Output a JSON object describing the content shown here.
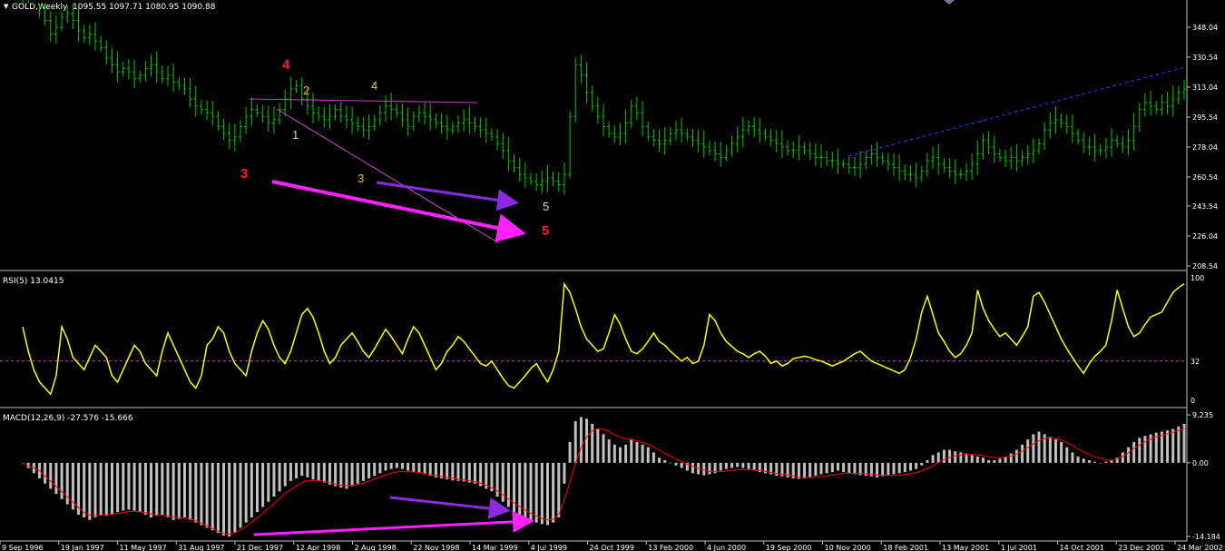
{
  "window": {
    "symbol_title": "GOLD,Weekly",
    "ohlc": "1095.55 1097.71 1080.95 1090.88"
  },
  "colors": {
    "background": "#000000",
    "candles": "#00c800",
    "rsi_line": "#ffff00",
    "macd_hist": "#c0c0c0",
    "macd_signal": "#ff0000",
    "trendline": "#cc44cc",
    "arrow_magenta": "#ff22ff",
    "arrow_violet": "#8a2be2",
    "channel_blue": "#2a3cff",
    "wave_red": "#ff2020",
    "wave_yellow": "#e8c040",
    "wave_white": "#d8d8d8"
  },
  "chart_data": [
    {
      "type": "candlestick",
      "title": "GOLD,Weekly",
      "y_ticks": [
        "348.04",
        "330.54",
        "313.04",
        "295.54",
        "278.04",
        "260.54",
        "243.54",
        "226.04",
        "208.54"
      ],
      "ylim": [
        208.54,
        348.04
      ],
      "x_ticks": [
        "9 Sep 1996",
        "19 Jan 1997",
        "11 May 1997",
        "31 Aug 1997",
        "21 Dec 1997",
        "12 Apr 1998",
        "2 Aug 1998",
        "22 Nov 1998",
        "14 Mar 1999",
        "4 Jul 1999",
        "24 Oct 1999",
        "13 Feb 2000",
        "4 Jun 2000",
        "19 Sep 2000",
        "10 Nov 2000",
        "18 Feb 2001",
        "13 May 2001",
        "1 Jul 2001",
        "14 Oct 2001",
        "23 Dec 2001",
        "24 Mar 2002"
      ],
      "series": [
        {
          "close": [
            378,
            372,
            366,
            360,
            352,
            344,
            348,
            354,
            356,
            352,
            346,
            342,
            344,
            340,
            336,
            330,
            326,
            322,
            324,
            322,
            318,
            320,
            324,
            326,
            322,
            318,
            320,
            316,
            314,
            312,
            306,
            302,
            300,
            298,
            296,
            290,
            286,
            282,
            284,
            290,
            296,
            300,
            298,
            296,
            292,
            294,
            300,
            306,
            312,
            314,
            306,
            302,
            298,
            296,
            294,
            296,
            300,
            296,
            294,
            292,
            290,
            288,
            290,
            294,
            298,
            302,
            300,
            298,
            294,
            290,
            296,
            298,
            296,
            294,
            292,
            290,
            288,
            290,
            292,
            294,
            292,
            290,
            288,
            286,
            284,
            280,
            276,
            270,
            266,
            262,
            260,
            258,
            256,
            258,
            260,
            258,
            256,
            262,
            296,
            326,
            320,
            310,
            302,
            296,
            290,
            286,
            284,
            286,
            292,
            302,
            298,
            290,
            284,
            282,
            280,
            282,
            286,
            288,
            286,
            284,
            282,
            280,
            278,
            276,
            274,
            272,
            276,
            280,
            284,
            288,
            290,
            288,
            286,
            284,
            282,
            280,
            278,
            276,
            276,
            278,
            276,
            274,
            272,
            272,
            270,
            270,
            268,
            268,
            266,
            266,
            268,
            272,
            274,
            272,
            270,
            268,
            266,
            264,
            262,
            262,
            260,
            264,
            270,
            272,
            268,
            266,
            264,
            262,
            262,
            264,
            268,
            274,
            282,
            278,
            274,
            272,
            270,
            272,
            270,
            272,
            274,
            276,
            280,
            288,
            292,
            294,
            292,
            290,
            286,
            282,
            278,
            278,
            276,
            276,
            278,
            282,
            280,
            278,
            282,
            290,
            300,
            304,
            302,
            300,
            304,
            302,
            306,
            310,
            312
          ]
        },
        {
          "name": "RSI(5) 13.0415",
          "values": [
            60,
            40,
            25,
            15,
            10,
            5,
            20,
            60,
            50,
            35,
            30,
            25,
            35,
            45,
            40,
            35,
            20,
            15,
            25,
            35,
            45,
            40,
            30,
            25,
            20,
            40,
            55,
            45,
            35,
            25,
            15,
            10,
            20,
            45,
            50,
            60,
            55,
            40,
            30,
            25,
            20,
            40,
            55,
            65,
            58,
            45,
            35,
            30,
            40,
            55,
            70,
            75,
            68,
            55,
            40,
            30,
            35,
            45,
            50,
            55,
            48,
            40,
            35,
            42,
            50,
            58,
            52,
            45,
            38,
            50,
            60,
            55,
            45,
            35,
            25,
            30,
            40,
            45,
            52,
            48,
            42,
            36,
            30,
            28,
            32,
            25,
            18,
            12,
            10,
            15,
            20,
            26,
            30,
            22,
            15,
            25,
            40,
            95,
            88,
            75,
            60,
            50,
            45,
            40,
            42,
            55,
            70,
            62,
            50,
            40,
            38,
            42,
            48,
            55,
            48,
            45,
            40,
            36,
            32,
            35,
            30,
            32,
            45,
            70,
            65,
            55,
            48,
            44,
            40,
            38,
            35,
            38,
            40,
            36,
            30,
            32,
            28,
            30,
            34,
            35,
            36,
            35,
            33,
            32,
            30,
            28,
            30,
            32,
            35,
            38,
            40,
            36,
            32,
            30,
            28,
            26,
            24,
            22,
            25,
            35,
            50,
            72,
            85,
            70,
            55,
            48,
            40,
            35,
            38,
            45,
            55,
            90,
            75,
            65,
            58,
            52,
            55,
            50,
            45,
            52,
            60,
            85,
            88,
            80,
            70,
            60,
            50,
            42,
            35,
            28,
            22,
            30,
            36,
            40,
            45,
            65,
            90,
            75,
            60,
            52,
            55,
            62,
            68,
            70,
            72,
            80,
            88,
            92,
            95
          ],
          "levels": [
            "100",
            "32",
            "0"
          ],
          "ylim": [
            0,
            100
          ]
        },
        {
          "name": "MACD(12,26,9) -27.576 -15.666",
          "histogram": [
            0,
            -1,
            -2,
            -3,
            -4,
            -5,
            -6,
            -7,
            -8,
            -9,
            -10,
            -10.5,
            -11,
            -10.5,
            -10,
            -10.2,
            -10,
            -9.5,
            -9.2,
            -9,
            -9.2,
            -9.5,
            -10,
            -10.5,
            -10.2,
            -10,
            -10.5,
            -11,
            -10.8,
            -10.5,
            -11,
            -11.5,
            -12,
            -12.5,
            -13,
            -13.5,
            -14,
            -14.2,
            -13.5,
            -12.5,
            -11.5,
            -10.5,
            -9.5,
            -8.5,
            -7.5,
            -6.5,
            -5.5,
            -4.5,
            -3.5,
            -3,
            -2.5,
            -2.8,
            -3.2,
            -3.5,
            -3.8,
            -4.2,
            -4.5,
            -4.8,
            -5,
            -4.5,
            -4,
            -3.5,
            -3,
            -2.5,
            -2,
            -1.5,
            -1.2,
            -1,
            -1.2,
            -1.5,
            -1.8,
            -2,
            -2.2,
            -2.5,
            -2.8,
            -3,
            -3.2,
            -3.4,
            -3.5,
            -3.6,
            -3.8,
            -4,
            -4.5,
            -5,
            -5.5,
            -6.5,
            -7.5,
            -8.5,
            -9.5,
            -10,
            -10.5,
            -11,
            -11.5,
            -11.8,
            -12,
            -11.5,
            -10.5,
            -4,
            4,
            8,
            8.8,
            8.5,
            7.5,
            6.5,
            5.5,
            4.5,
            3.5,
            3,
            3.5,
            4.5,
            4,
            3.5,
            3,
            2,
            1,
            0.5,
            0,
            -0.5,
            -1,
            -1.5,
            -2,
            -2.2,
            -2.4,
            -2.2,
            -2,
            -1.5,
            -1.2,
            -1,
            -0.8,
            -1,
            -1.2,
            -1.5,
            -1.8,
            -2,
            -2.2,
            -2.5,
            -2.6,
            -2.8,
            -3,
            -3.1,
            -3,
            -2.8,
            -2.5,
            -2.2,
            -2,
            -1.8,
            -1.5,
            -1.8,
            -2,
            -2.2,
            -2.4,
            -2.5,
            -2.6,
            -2.8,
            -2.6,
            -2.4,
            -2.2,
            -2,
            -1.8,
            -1.5,
            -1.2,
            -0.5,
            0.5,
            1.5,
            2,
            2.5,
            2.5,
            2.2,
            2,
            1.8,
            1.5,
            1.2,
            1,
            0.5,
            0.5,
            0.8,
            1.2,
            1.8,
            2.5,
            3.5,
            4.5,
            5.5,
            6,
            5.5,
            5,
            4.5,
            4,
            3,
            2,
            1.2,
            0.8,
            0.5,
            0.2,
            0,
            0.2,
            0.5,
            1,
            2,
            3,
            4,
            4.8,
            5.2,
            5.5,
            5.8,
            6,
            6.2,
            6.5,
            7,
            7.5
          ],
          "signal": [
            0,
            -0.5,
            -1,
            -1.5,
            -2.5,
            -3.5,
            -4.5,
            -5.5,
            -6.5,
            -7.5,
            -8.5,
            -9.5,
            -10,
            -10.2,
            -10.1,
            -10,
            -9.9,
            -9.8,
            -9.6,
            -9.4,
            -9.3,
            -9.4,
            -9.6,
            -9.8,
            -10,
            -10.1,
            -10.2,
            -10.4,
            -10.5,
            -10.6,
            -10.8,
            -11,
            -11.5,
            -12,
            -12.5,
            -13,
            -13.5,
            -13.8,
            -13.6,
            -13.1,
            -12.5,
            -11.8,
            -11,
            -10.1,
            -9.2,
            -8.3,
            -7.3,
            -6.4,
            -5.5,
            -4.8,
            -4.1,
            -3.6,
            -3.4,
            -3.4,
            -3.5,
            -3.7,
            -3.9,
            -4.2,
            -4.4,
            -4.4,
            -4.3,
            -4.1,
            -3.8,
            -3.4,
            -3,
            -2.6,
            -2.2,
            -1.9,
            -1.7,
            -1.7,
            -1.7,
            -1.8,
            -1.9,
            -2.1,
            -2.3,
            -2.5,
            -2.7,
            -2.9,
            -3,
            -3.2,
            -3.3,
            -3.5,
            -3.7,
            -4,
            -4.4,
            -4.9,
            -5.5,
            -6.3,
            -7.1,
            -7.8,
            -8.5,
            -9.2,
            -9.8,
            -10.3,
            -10.8,
            -11,
            -10.9,
            -9.8,
            -7,
            -3.5,
            0,
            3,
            5,
            6.2,
            6.6,
            6.5,
            6,
            5.4,
            4.9,
            4.6,
            4.5,
            4.3,
            4,
            3.6,
            3.1,
            2.5,
            1.9,
            1.4,
            0.8,
            0.3,
            -0.2,
            -0.6,
            -1,
            -1.3,
            -1.6,
            -1.7,
            -1.7,
            -1.6,
            -1.5,
            -1.4,
            -1.3,
            -1.3,
            -1.4,
            -1.5,
            -1.6,
            -1.8,
            -2,
            -2.2,
            -2.3,
            -2.5,
            -2.7,
            -2.8,
            -2.8,
            -2.8,
            -2.7,
            -2.6,
            -2.4,
            -2.3,
            -2.1,
            -2,
            -2,
            -2.1,
            -2.1,
            -2.2,
            -2.3,
            -2.4,
            -2.4,
            -2.4,
            -2.4,
            -2.3,
            -2.2,
            -2,
            -1.8,
            -1.4,
            -0.9,
            -0.3,
            0.3,
            0.8,
            1.2,
            1.4,
            1.6,
            1.6,
            1.6,
            1.5,
            1.3,
            1.1,
            1,
            1,
            1.1,
            1.4,
            1.8,
            2.4,
            3.1,
            3.8,
            4.4,
            4.7,
            4.8,
            4.6,
            4.3,
            3.8,
            3.2,
            2.6,
            2,
            1.5,
            1.1,
            0.8,
            0.5,
            0.5,
            0.8,
            1.3,
            2,
            2.8,
            3.5,
            4.1,
            4.6,
            5,
            5.3,
            5.6,
            5.9,
            6.2,
            6.6
          ],
          "y_ticks": [
            "9.235",
            "0.00",
            "-14.184"
          ],
          "ylim": [
            -14.184,
            9.235
          ]
        }
      ],
      "annotations": {
        "waves_red": [
          "3",
          "4",
          "5"
        ],
        "waves_yellow": [
          "2",
          "4",
          "3"
        ],
        "waves_white": [
          "1",
          "5"
        ]
      }
    }
  ]
}
